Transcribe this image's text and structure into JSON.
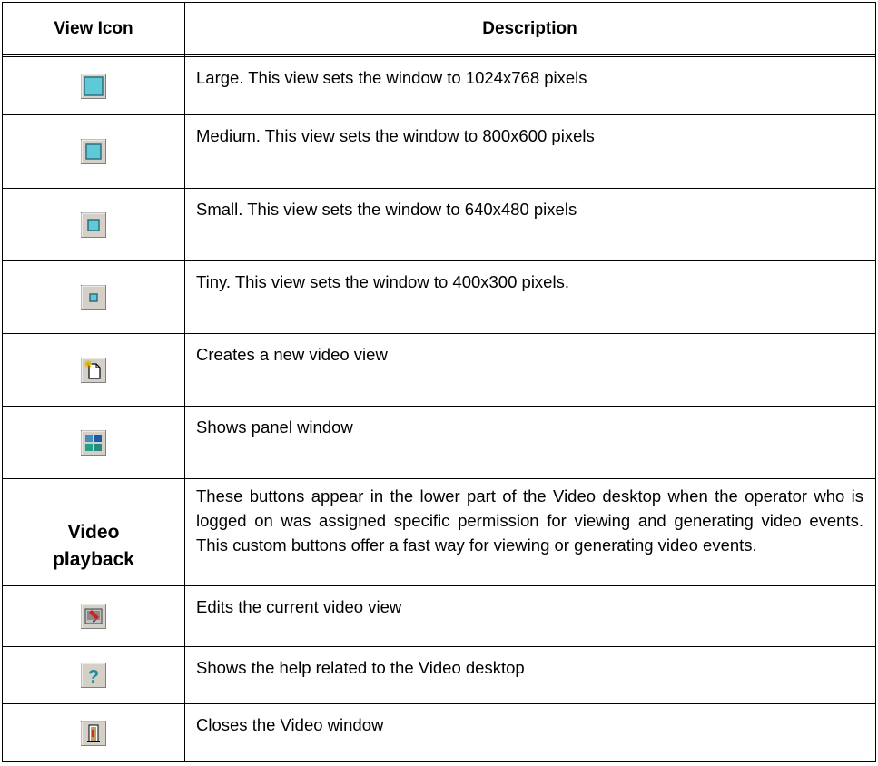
{
  "table": {
    "header": {
      "icon_col": "View Icon",
      "desc_col": "Description"
    },
    "rows": [
      {
        "icon": "large-view-icon",
        "description": "Large. This view sets the window to 1024x768 pixels"
      },
      {
        "icon": "medium-view-icon",
        "description": "Medium. This view sets the window to 800x600 pixels"
      },
      {
        "icon": "small-view-icon",
        "description": "Small. This view sets the window to 640x480 pixels"
      },
      {
        "icon": "tiny-view-icon",
        "description": "Tiny. This view sets the window to 400x300 pixels."
      },
      {
        "icon": "new-video-view-icon",
        "description": "Creates a new video view"
      },
      {
        "icon": "panel-window-icon",
        "description": "Shows panel window"
      },
      {
        "icon_text": "Video playback",
        "description": "These buttons appear in the lower part of the Video desktop when the operator who is logged on was assigned specific permission for viewing and generating video events. This custom buttons offer a fast way for viewing or generating video events."
      },
      {
        "icon": "edit-view-icon",
        "description": "Edits the current video view"
      },
      {
        "icon": "help-icon",
        "description": "Shows the help related to the Video desktop"
      },
      {
        "icon": "close-window-icon",
        "description": "Closes the Video window"
      }
    ]
  }
}
